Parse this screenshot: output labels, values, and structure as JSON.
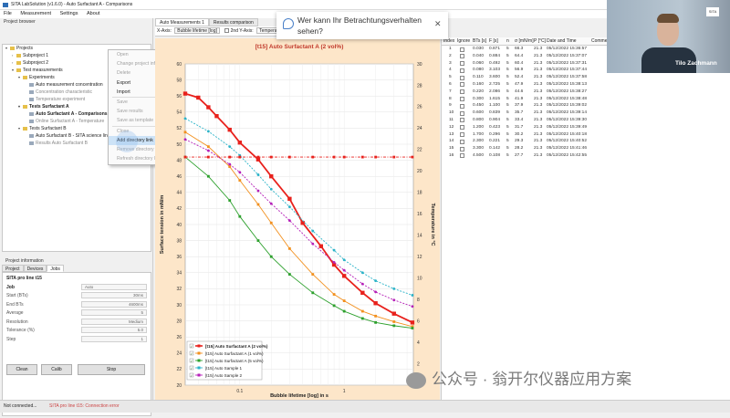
{
  "window": {
    "title": "SITA LabSolution (v1.6.0) - Auto Surfactant A - Comparisons"
  },
  "menu": [
    "File",
    "Measurement",
    "Settings",
    "About"
  ],
  "left": {
    "browser_title": "Project browser",
    "tree": [
      {
        "label": "Projects",
        "level": 0,
        "bold": false,
        "toggle": "▾"
      },
      {
        "label": "Subproject 1",
        "level": 1,
        "bold": false,
        "toggle": "›"
      },
      {
        "label": "Subproject 2",
        "level": 1,
        "bold": false,
        "toggle": "›"
      },
      {
        "label": "Test measurements",
        "level": 1,
        "bold": false,
        "toggle": "▾"
      },
      {
        "label": "Experiments",
        "level": 2,
        "bold": false,
        "toggle": "▾"
      },
      {
        "label": "Auto measurement concentration",
        "level": 3,
        "bold": false,
        "toggle": ""
      },
      {
        "label": "Concentration characteristic",
        "level": 3,
        "bold": false,
        "toggle": "",
        "grey": true
      },
      {
        "label": "Temperature experiment",
        "level": 3,
        "bold": false,
        "toggle": "",
        "grey": true
      },
      {
        "label": "Tests Surfactant A",
        "level": 2,
        "bold": true,
        "toggle": "▾"
      },
      {
        "label": "Auto Surfactant A - Comparisons",
        "level": 3,
        "bold": true,
        "toggle": ""
      },
      {
        "label": "Online Surfactant A - Temperature",
        "level": 3,
        "bold": false,
        "toggle": "",
        "grey": true
      },
      {
        "label": "Tests Surfactant B",
        "level": 2,
        "bold": false,
        "toggle": "▾"
      },
      {
        "label": "Auto Surfactant B - SITA science line (10",
        "level": 3,
        "bold": false,
        "toggle": ""
      },
      {
        "label": "Results Auto Surfactant B",
        "level": 3,
        "bold": false,
        "toggle": "",
        "grey": true
      }
    ],
    "context_menu": [
      {
        "label": "Open",
        "disabled": true
      },
      {
        "label": "Change project information",
        "disabled": true
      },
      {
        "label": "Delete",
        "disabled": true
      },
      {
        "label": "Export",
        "disabled": false
      },
      {
        "label": "Import",
        "disabled": false
      },
      {
        "label": "sep"
      },
      {
        "label": "Save",
        "disabled": true
      },
      {
        "label": "Save results",
        "disabled": true
      },
      {
        "label": "Save as template",
        "disabled": true
      },
      {
        "label": "sep"
      },
      {
        "label": "Close",
        "disabled": true
      },
      {
        "label": "Add directory link",
        "disabled": false,
        "highlight": true
      },
      {
        "label": "Remove directory link",
        "disabled": true
      },
      {
        "label": "Refresh directory link",
        "disabled": true
      }
    ],
    "info_title": "Project information",
    "info_tabs": [
      "Project",
      "Devices",
      "Jobs"
    ],
    "profile_title": "SITA pro line t15",
    "job_label": "Job",
    "job_value": "Auto",
    "fields": [
      {
        "label": "Start (BTs)",
        "value": "30ms"
      },
      {
        "label": "End BTs",
        "value": "4600ms"
      },
      {
        "label": "Average",
        "value": "5"
      },
      {
        "label": "Resolution",
        "value": "Medium"
      },
      {
        "label": "Tolerance (%)",
        "value": "5.0"
      },
      {
        "label": "Step",
        "value": "1"
      }
    ],
    "buttons": {
      "clean": "Clean",
      "calib": "Calib",
      "stop": "Stop"
    }
  },
  "status": {
    "left": "Not connected...",
    "right": "SITA pro line t15: Connection error"
  },
  "mid": {
    "tabs": [
      "Auto Measurements 1",
      "Results comparison"
    ],
    "toolbar": {
      "xaxis_label": "X-Axis:",
      "xaxis_value": "Bubble lifetime [log]",
      "yaxis2_label": "2nd Y-Axis:",
      "yaxis2_value": "Temperature"
    }
  },
  "chart_data": {
    "type": "line",
    "title": "[t15] Auto Surfactant A (2 vol%)",
    "xlabel": "Bubble lifetime [log] in s",
    "ylabel": "Surface tension in mN/m",
    "y2label": "Temperature in °C",
    "xscale": "log",
    "xlim": [
      0.03,
      4.6
    ],
    "xticks": [
      0.1,
      1
    ],
    "xticklabels": [
      "0.1",
      "1"
    ],
    "ylim": [
      20,
      60
    ],
    "yticks": [
      20,
      22,
      24,
      26,
      28,
      30,
      32,
      34,
      36,
      38,
      40,
      42,
      44,
      46,
      48,
      50,
      52,
      54,
      56,
      58,
      60
    ],
    "y2lim": [
      0,
      30
    ],
    "y2ticks": [
      0,
      2,
      4,
      6,
      8,
      10,
      12,
      14,
      16,
      18,
      20,
      22,
      24,
      26,
      28,
      30
    ],
    "grid": true,
    "legend_position": "bottom-left",
    "legend_checked": [
      true,
      true,
      true,
      true,
      true
    ],
    "series": [
      {
        "name": "[t15] Auto Surfactant A (2 vol%)",
        "color": "#e8211c",
        "style": "solid",
        "marker": "square",
        "bold": true,
        "x": [
          0.03,
          0.04,
          0.05,
          0.06,
          0.08,
          0.1,
          0.15,
          0.2,
          0.3,
          0.4,
          0.6,
          0.8,
          1.0,
          1.5,
          2.0,
          3.0,
          4.5
        ],
        "y": [
          56.3,
          55.8,
          54.6,
          53.5,
          51.8,
          50.2,
          48.1,
          46.0,
          43.2,
          40.2,
          37.3,
          35.0,
          33.6,
          31.5,
          30.2,
          28.9,
          27.8
        ]
      },
      {
        "name": "[t15] Auto Surfactant A (1 vol%)",
        "color": "#f2901e",
        "style": "solid",
        "marker": "square",
        "bold": false,
        "x": [
          0.03,
          0.05,
          0.08,
          0.1,
          0.15,
          0.2,
          0.3,
          0.5,
          0.8,
          1.0,
          1.5,
          2.0,
          3.0,
          4.5
        ],
        "y": [
          51.5,
          49.7,
          47.2,
          45.5,
          42.5,
          40.2,
          37.0,
          33.8,
          31.3,
          30.5,
          29.2,
          28.6,
          27.9,
          27.3
        ]
      },
      {
        "name": "[t15] Auto Surfactant A (5 vol%)",
        "color": "#2ca02c",
        "style": "solid",
        "marker": "square",
        "bold": false,
        "x": [
          0.03,
          0.05,
          0.08,
          0.1,
          0.15,
          0.2,
          0.3,
          0.5,
          0.8,
          1.0,
          1.5,
          2.0,
          3.0,
          4.5
        ],
        "y": [
          48.4,
          46.0,
          43.0,
          41.0,
          38.0,
          36.0,
          33.8,
          31.5,
          29.9,
          29.2,
          28.3,
          27.8,
          27.4,
          27.1
        ]
      },
      {
        "name": "[t15] Auto Sample 1",
        "color": "#2bb3c8",
        "style": "dashed",
        "marker": "circle",
        "bold": false,
        "x": [
          0.03,
          0.05,
          0.08,
          0.1,
          0.15,
          0.2,
          0.3,
          0.5,
          0.8,
          1.0,
          1.5,
          2.0,
          3.0,
          4.5
        ],
        "y": [
          53.2,
          51.6,
          49.7,
          48.6,
          46.2,
          44.4,
          42.2,
          39.2,
          36.8,
          35.6,
          34.0,
          33.0,
          32.0,
          31.2
        ]
      },
      {
        "name": "[t15] Auto Sample 2",
        "color": "#b51fb8",
        "style": "dashed",
        "marker": "circle",
        "bold": false,
        "x": [
          0.03,
          0.05,
          0.08,
          0.1,
          0.15,
          0.2,
          0.3,
          0.5,
          0.8,
          1.0,
          1.5,
          2.0,
          3.0,
          4.5
        ],
        "y": [
          50.6,
          49.2,
          47.5,
          46.5,
          44.2,
          42.6,
          40.5,
          37.6,
          35.3,
          34.3,
          32.6,
          31.6,
          30.6,
          29.8
        ]
      },
      {
        "name": "",
        "color": "#e8211c",
        "style": "dashdot",
        "marker": "square",
        "axis": "y2",
        "bold": false,
        "x": [
          0.03,
          0.05,
          0.08,
          0.1,
          0.15,
          0.2,
          0.3,
          0.5,
          0.8,
          1.0,
          1.5,
          2.0,
          3.0,
          4.5
        ],
        "y": [
          21.3,
          21.3,
          21.3,
          21.3,
          21.3,
          21.3,
          21.3,
          21.3,
          21.3,
          21.3,
          21.3,
          21.3,
          21.3,
          21.3
        ]
      }
    ]
  },
  "table": {
    "headers": [
      "Index",
      "Ignore",
      "BTs [s]",
      "F [s]",
      "n",
      "σ [mN/m]",
      "P [°C]",
      "Date and Time",
      "Comment"
    ],
    "rows": [
      [
        "1",
        "0.030",
        "0.871",
        "5",
        "66.3",
        "21.3",
        "05/12/2022 15:36:57"
      ],
      [
        "2",
        "0.040",
        "0.884",
        "5",
        "64.4",
        "21.3",
        "05/12/2022 15:37:07"
      ],
      [
        "3",
        "0.060",
        "0.492",
        "5",
        "60.4",
        "21.3",
        "05/12/2022 15:37:31"
      ],
      [
        "4",
        "0.080",
        "3.103",
        "5",
        "56.9",
        "21.3",
        "05/12/2022 15:37:44"
      ],
      [
        "5",
        "0.110",
        "3.600",
        "5",
        "52.4",
        "21.3",
        "05/12/2022 15:37:58"
      ],
      [
        "6",
        "0.160",
        "2.725",
        "5",
        "47.9",
        "21.3",
        "05/12/2022 15:38:13"
      ],
      [
        "7",
        "0.220",
        "2.086",
        "5",
        "44.6",
        "21.3",
        "05/12/2022 15:38:27"
      ],
      [
        "8",
        "0.300",
        "1.615",
        "5",
        "41.9",
        "21.3",
        "05/12/2022 15:38:48"
      ],
      [
        "9",
        "0.450",
        "1.100",
        "5",
        "37.9",
        "21.3",
        "05/12/2022 15:39:02"
      ],
      [
        "10",
        "0.600",
        "0.839",
        "5",
        "35.7",
        "21.3",
        "05/12/2022 15:39:14"
      ],
      [
        "11",
        "0.800",
        "0.904",
        "5",
        "33.4",
        "21.3",
        "05/12/2022 15:39:30"
      ],
      [
        "12",
        "1.200",
        "0.423",
        "5",
        "31.7",
        "21.3",
        "05/12/2022 15:39:49"
      ],
      [
        "13",
        "1.700",
        "0.296",
        "5",
        "30.2",
        "21.3",
        "05/12/2022 15:40:18"
      ],
      [
        "14",
        "2.300",
        "0.221",
        "5",
        "29.3",
        "21.3",
        "05/12/2022 15:40:52"
      ],
      [
        "15",
        "3.300",
        "0.142",
        "5",
        "28.2",
        "21.3",
        "05/12/2022 15:41:46"
      ],
      [
        "16",
        "4.500",
        "0.108",
        "5",
        "27.7",
        "21.3",
        "05/12/2022 15:42:55"
      ]
    ]
  },
  "survey": {
    "text": "Wer kann Ihr Betrachtungsverhalten sehen?"
  },
  "video": {
    "name": "Tilo Zachmann",
    "logo": "SITA"
  },
  "watermark": "公众号 · 翁开尔仪器应用方案"
}
